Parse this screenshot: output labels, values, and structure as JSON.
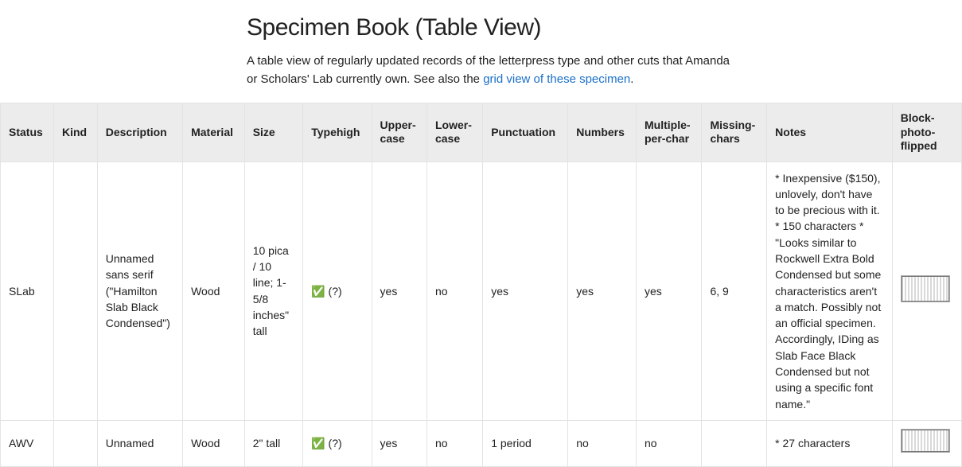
{
  "page": {
    "title": "Specimen Book (Table View)",
    "desc_pre": "A table view of regularly updated records of the letterpress type and other cuts that Amanda or Scholars' Lab currently own. See also the ",
    "desc_link": "grid view of these specimen",
    "desc_post": "."
  },
  "table": {
    "headers": {
      "status": "Status",
      "kind": "Kind",
      "description": "Description",
      "material": "Material",
      "size": "Size",
      "typehigh": "Typehigh",
      "upper": "Upper-case",
      "lower": "Lower-case",
      "punct": "Punctuation",
      "numbers": "Numbers",
      "multi": "Multiple-per-char",
      "missing": "Missing-chars",
      "notes": "Notes",
      "photo": "Block-photo-flipped"
    },
    "rows": [
      {
        "status": "SLab",
        "kind": "",
        "description": "Unnamed sans serif (\"Hamilton Slab Black Condensed\")",
        "material": "Wood",
        "size": "10 pica / 10 line; 1-5/8 inches\" tall",
        "typehigh": "✅ (?)",
        "upper": "yes",
        "lower": "no",
        "punct": "yes",
        "numbers": "yes",
        "multi": "yes",
        "missing": "6, 9",
        "notes": "* Inexpensive ($150), unlovely, don't have to be precious with it. * 150 characters * \"Looks similar to Rockwell Extra Bold Condensed but some characteristics aren't a match. Possibly not an official specimen. Accordingly, IDing as Slab Face Black Condensed but not using a specific font name.\"",
        "has_photo": true
      },
      {
        "status": "AWV",
        "kind": "",
        "description": "Unnamed",
        "material": "Wood",
        "size": "2\" tall",
        "typehigh": "✅ (?)",
        "upper": "yes",
        "lower": "no",
        "punct": "1 period",
        "numbers": "no",
        "multi": "no",
        "missing": "",
        "notes": "* 27 characters",
        "has_photo": true
      }
    ]
  }
}
